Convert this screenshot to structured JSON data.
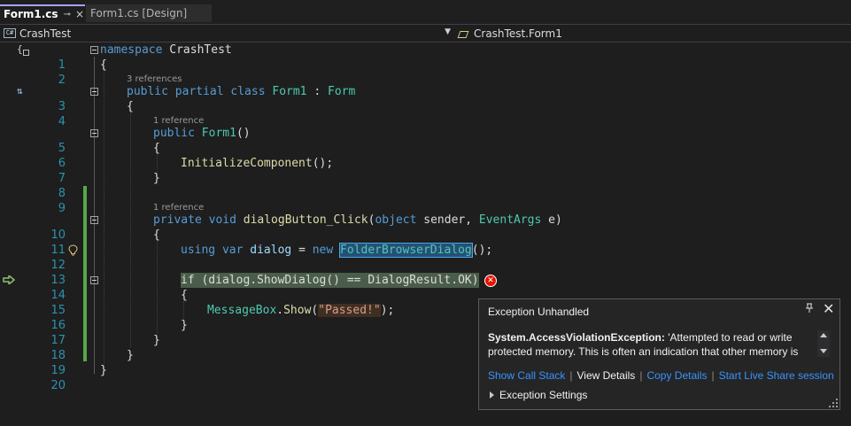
{
  "tabs": [
    {
      "title": "Form1.cs",
      "active": true,
      "pin": "⊸",
      "close": "×"
    },
    {
      "title": "Form1.cs [Design]",
      "active": false
    }
  ],
  "navbar": {
    "project_icon": "C#",
    "project": "CrashTest",
    "member": "CrashTest.Form1",
    "dropdown": "▼"
  },
  "gutter": {
    "glyph_1": "{",
    "glyph_3": "⇅"
  },
  "codelens": {
    "l3": "3 references",
    "l5": "1 reference",
    "l10": "1 reference"
  },
  "lines": {
    "n1": "1",
    "n2": "2",
    "n3": "3",
    "n4": "4",
    "n5": "5",
    "n6": "6",
    "n7": "7",
    "n8": "8",
    "n9": "9",
    "n10": "10",
    "n11": "11",
    "n12": "12",
    "n13": "13",
    "n14": "14",
    "n15": "15",
    "n16": "16",
    "n17": "17",
    "n18": "18",
    "n19": "19",
    "n20": "20"
  },
  "code": {
    "l1_kw": "namespace",
    "l1_name": " CrashTest",
    "l2": "{",
    "l3_kw": "public partial class",
    "l3_name": "Form1",
    "l3_colon": " : ",
    "l3_base": "Form",
    "l4": "{",
    "l5_kw": "public",
    "l5_name": "Form1",
    "l5_rest": "()",
    "l6": "{",
    "l7_m": "InitializeComponent",
    "l7_rest": "();",
    "l8": "}",
    "l10_kw": "private void",
    "l10_m": "dialogButton_Click",
    "l10_p1": "(",
    "l10_kw2": "object",
    "l10_sender": " sender, ",
    "l10_type": "EventArgs",
    "l10_rest": " e)",
    "l11": "{",
    "l12_kw": "using var",
    "l12_var": " dialog ",
    "l12_eq": "= ",
    "l12_kw2": "new",
    "l12_type": "FolderBrowserDialog",
    "l12_rest": "();",
    "l14": "if (dialog.ShowDialog() == DialogResult.OK)",
    "l15_t": "MessageBox",
    "l15_dot": ".",
    "l15_m": "Show",
    "l15_p": "(",
    "l15_s": "\"Passed!\"",
    "l15_rest": ");",
    "l16": "{",
    "l17": "}",
    "l18": "}",
    "l19": "}",
    "l20": "}"
  },
  "exception": {
    "title": "Exception Unhandled",
    "pin": "⊥",
    "close": "✕",
    "type": "System.AccessViolationException:",
    "message": " 'Attempted to read or write protected memory. This is often an indication that other memory is",
    "links": {
      "call_stack": "Show Call Stack",
      "view_details": "View Details",
      "copy_details": "Copy Details",
      "live_share": "Start Live Share session",
      "sep": "|"
    },
    "settings": "Exception Settings",
    "error_glyph": "✕"
  },
  "colors": {
    "keyword": "#569cd6",
    "type": "#4ec9b0",
    "method": "#dcdcaa",
    "string": "#d69d85",
    "line_number": "#2b91af",
    "change_bar": "#57a64a",
    "error": "#e51400",
    "link": "#3794ff"
  }
}
